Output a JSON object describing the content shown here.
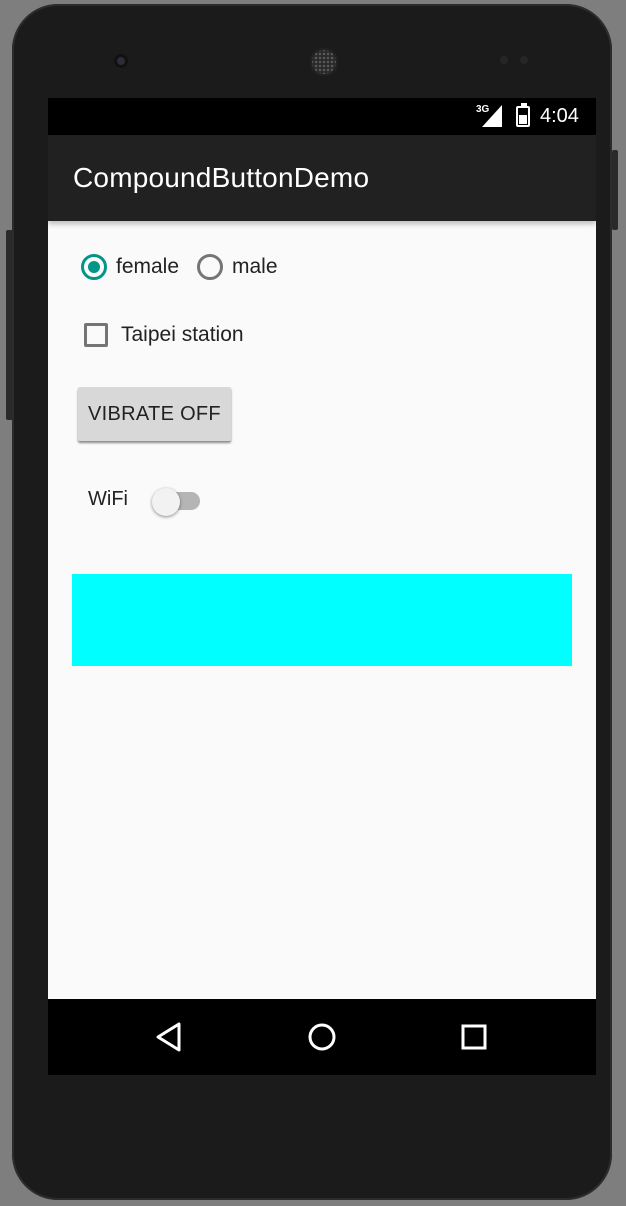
{
  "status_bar": {
    "network": "3G",
    "time": "4:04"
  },
  "app_bar": {
    "title": "CompoundButtonDemo"
  },
  "gender_group": {
    "options": [
      {
        "label": "female",
        "checked": true
      },
      {
        "label": "male",
        "checked": false
      }
    ]
  },
  "checkbox": {
    "label": "Taipei station",
    "checked": false
  },
  "toggle_button": {
    "label": "VIBRATE OFF"
  },
  "wifi_switch": {
    "label": "WiFi",
    "on": false
  },
  "color_box": {
    "color": "#00ffff"
  },
  "nav_bar": {
    "icons": [
      "back-icon",
      "home-icon",
      "recents-icon"
    ]
  },
  "colors": {
    "accent": "#009688",
    "app_bar": "#212121",
    "background": "#fafafa"
  }
}
